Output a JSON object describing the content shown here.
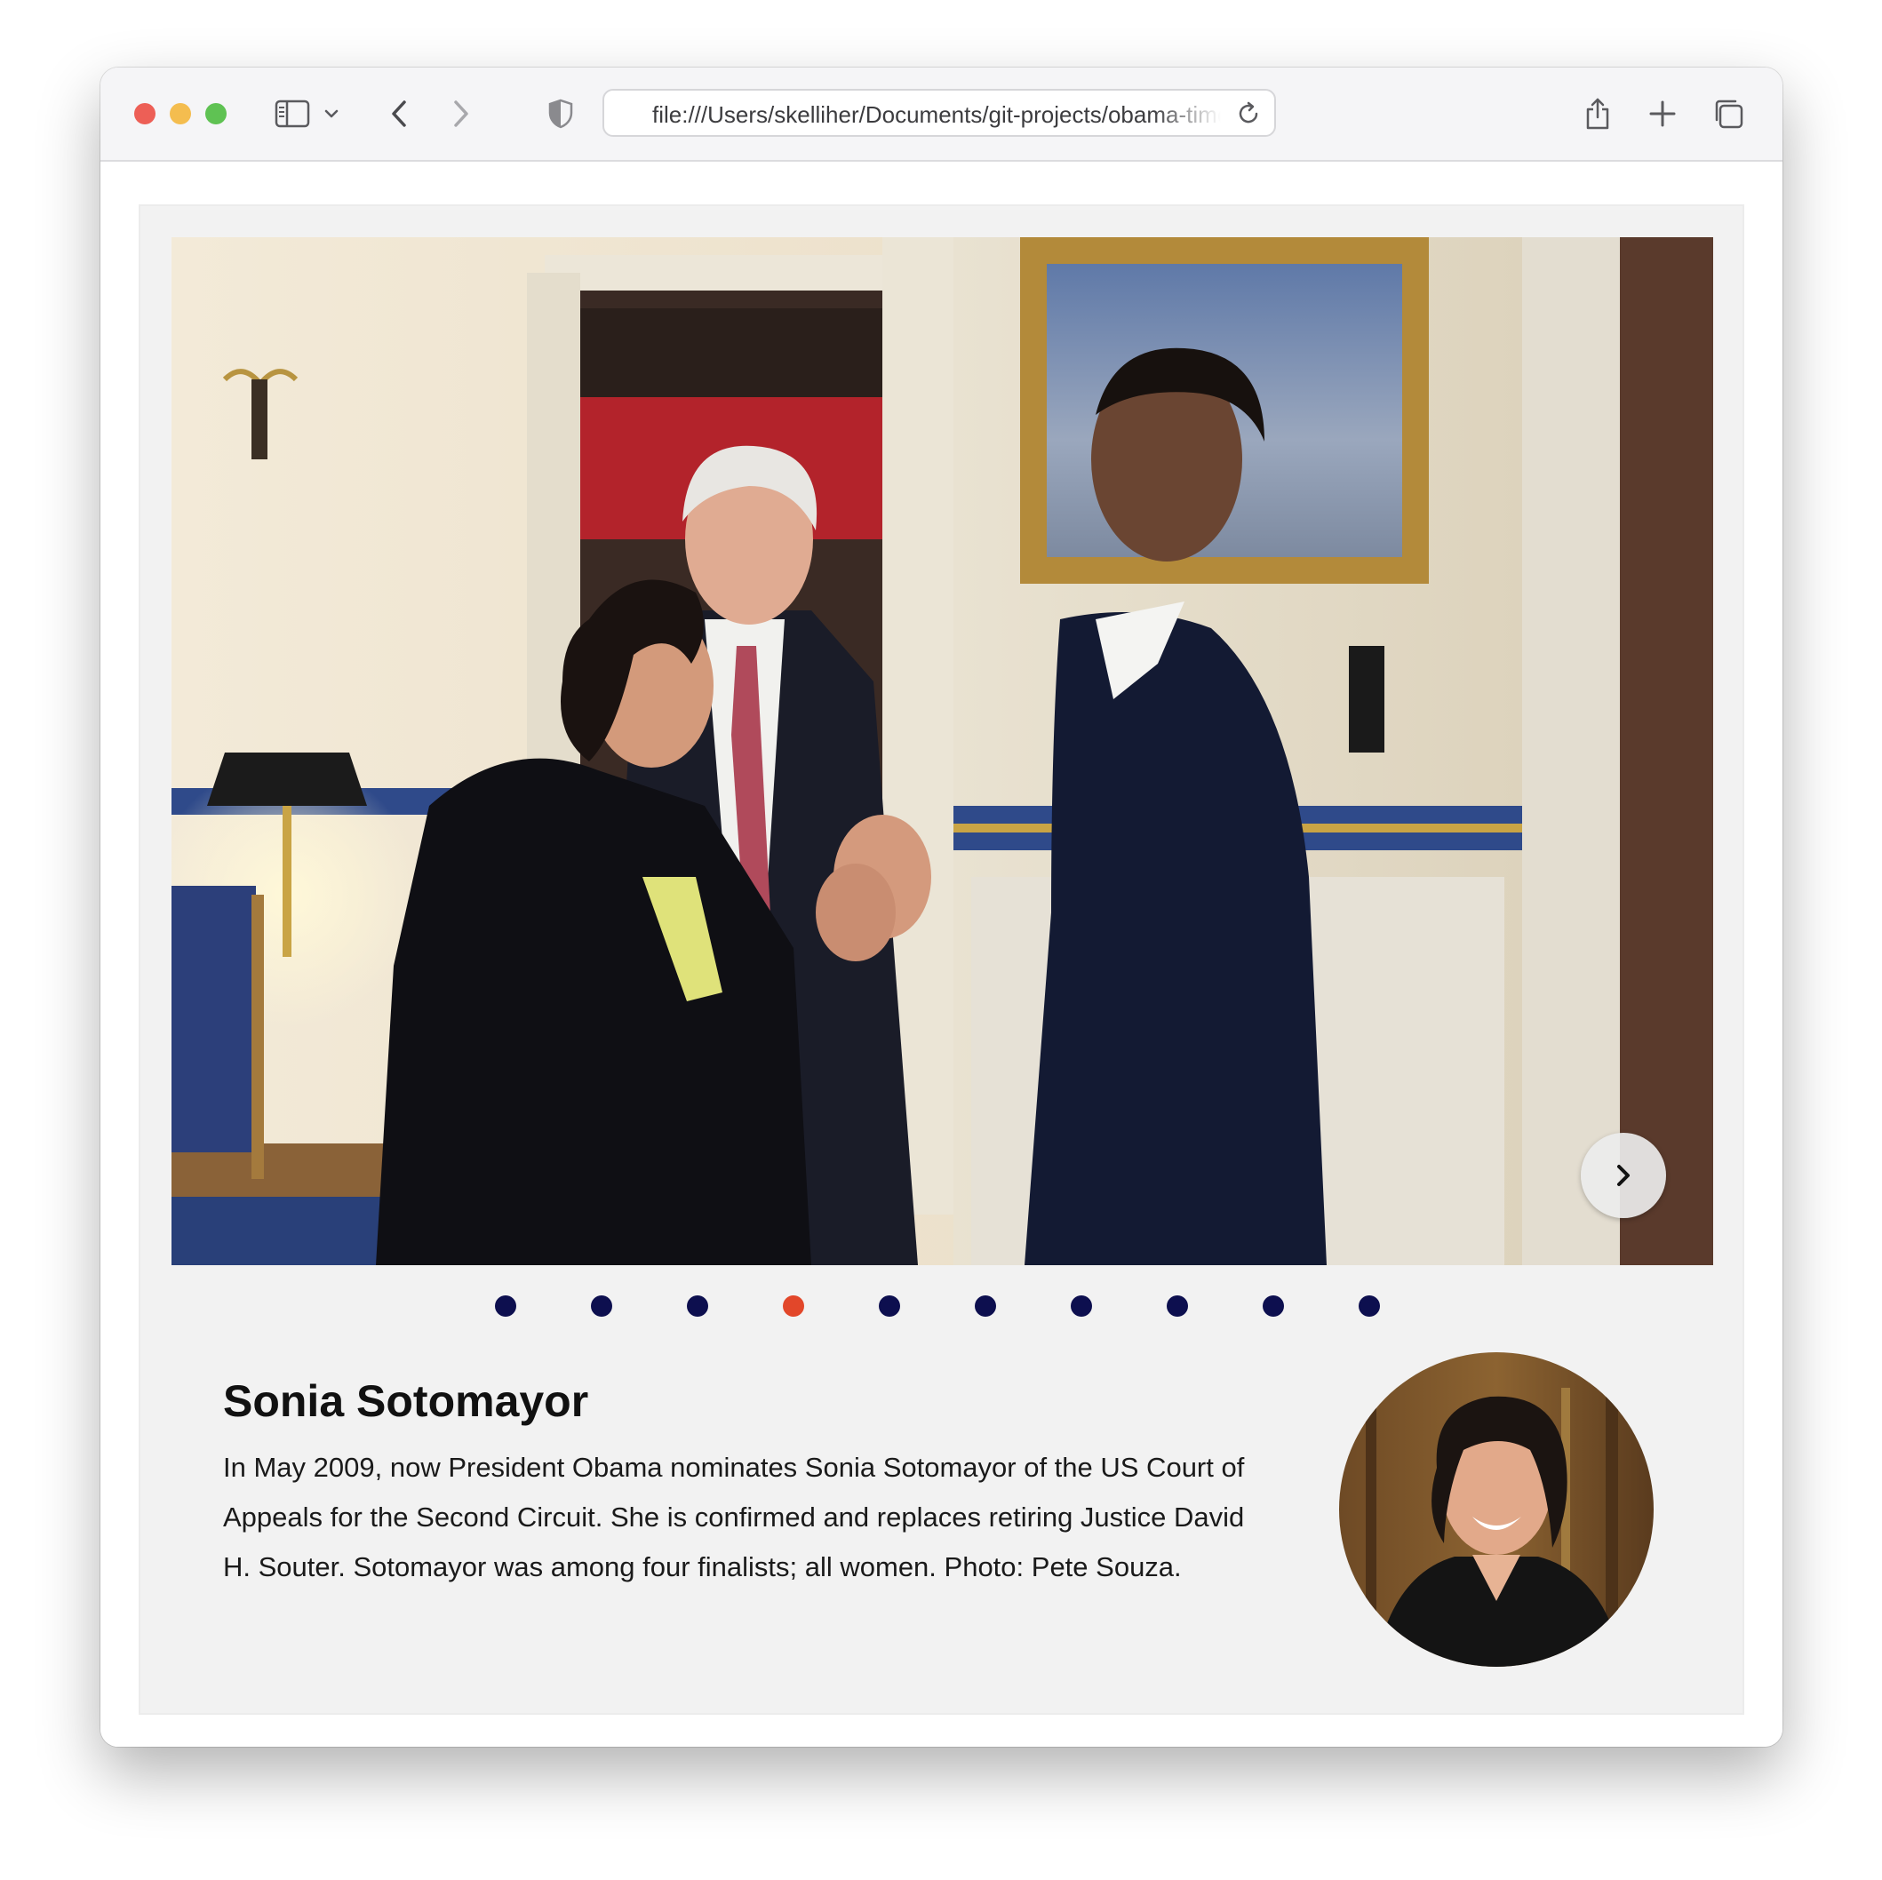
{
  "browser": {
    "url": "file:///Users/skelliher/Documents/git-projects/obama-timeline/index.html"
  },
  "icons": {
    "sidebar": "sidebar-icon",
    "back": "chevron-left-icon",
    "forward": "chevron-right-icon",
    "shield": "shield-icon",
    "reload": "reload-icon",
    "share": "share-icon",
    "new_tab": "plus-icon",
    "tabs": "tabs-overview-icon",
    "next": "chevron-right-icon"
  },
  "slideshow": {
    "total_slides": 10,
    "active_index": 3
  },
  "entry": {
    "title": "Sonia Sotomayor",
    "description": "In May 2009, now President Obama nominates Sonia Sotomayor of the US Court of Appeals for the Second Circuit. She is confirmed and replaces retiring Justice David H. Souter. Sotomayor was among four finalists; all women. Photo: Pete Souza."
  },
  "colors": {
    "dot_default": "#0d0f4f",
    "dot_active": "#e2472a",
    "card_background": "#f2f2f2"
  }
}
